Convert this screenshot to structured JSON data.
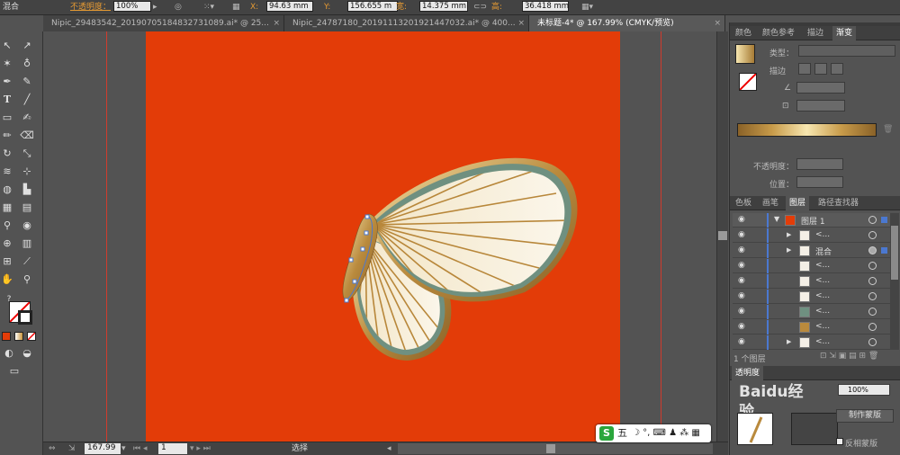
{
  "control_bar": {
    "mode_label": "混合",
    "opacity_label": "不透明度：",
    "opacity_value": "100%",
    "x_label": "X:",
    "x_value": "94.63 mm",
    "y_label": "Y:",
    "y_value": "156.655 m",
    "w_label": "宽:",
    "w_value": "14.375 mm",
    "h_label": "高:",
    "h_value": "36.418 mm"
  },
  "doc_tabs": [
    {
      "label": "Nipic_29483542_20190705184832731089.ai* @ 25...",
      "close": "×"
    },
    {
      "label": "Nipic_24787180_20191113201921447032.ai* @ 400...",
      "close": "×"
    },
    {
      "label": "未标题-4* @ 167.99% (CMYK/预览)",
      "close": "×"
    }
  ],
  "gradient_panel": {
    "tabs": [
      "颜色",
      "颜色参考",
      "描边",
      "渐变"
    ],
    "active_tab": "渐变",
    "type_label": "类型：",
    "stroke_label": "描边",
    "opacity_label": "不透明度：",
    "position_label": "位置："
  },
  "layers_panel": {
    "tabs": [
      "色板",
      "画笔",
      "图层",
      "路径查找器"
    ],
    "active_tab": "图层",
    "layer_name": "图层 1",
    "rows": [
      {
        "name": "<...",
        "expand": "▶"
      },
      {
        "name": "混合",
        "expand": "▶"
      },
      {
        "name": "<...",
        "expand": ""
      },
      {
        "name": "<...",
        "expand": ""
      },
      {
        "name": "<...",
        "expand": ""
      },
      {
        "name": "<...",
        "expand": ""
      },
      {
        "name": "<...",
        "expand": ""
      },
      {
        "name": "<...",
        "expand": "▶"
      }
    ],
    "footer_count": "1 个图层"
  },
  "transparency_panel": {
    "tab": "透明度",
    "opacity_value": "100%",
    "make_mask_button": "制作蒙版",
    "invert_mask_label": "反相蒙版",
    "watermark": "Baidu经验"
  },
  "status_bar": {
    "zoom": "167.99",
    "page": "1",
    "tool_name": "选择"
  },
  "ime_bar": {
    "logo": "S",
    "mode": "五",
    "icons": "☽ °, ⌨ ♟ ⁂ ▦"
  },
  "colors": {
    "artboard": "#e33c08",
    "accent_blue": "#4b78d0"
  }
}
